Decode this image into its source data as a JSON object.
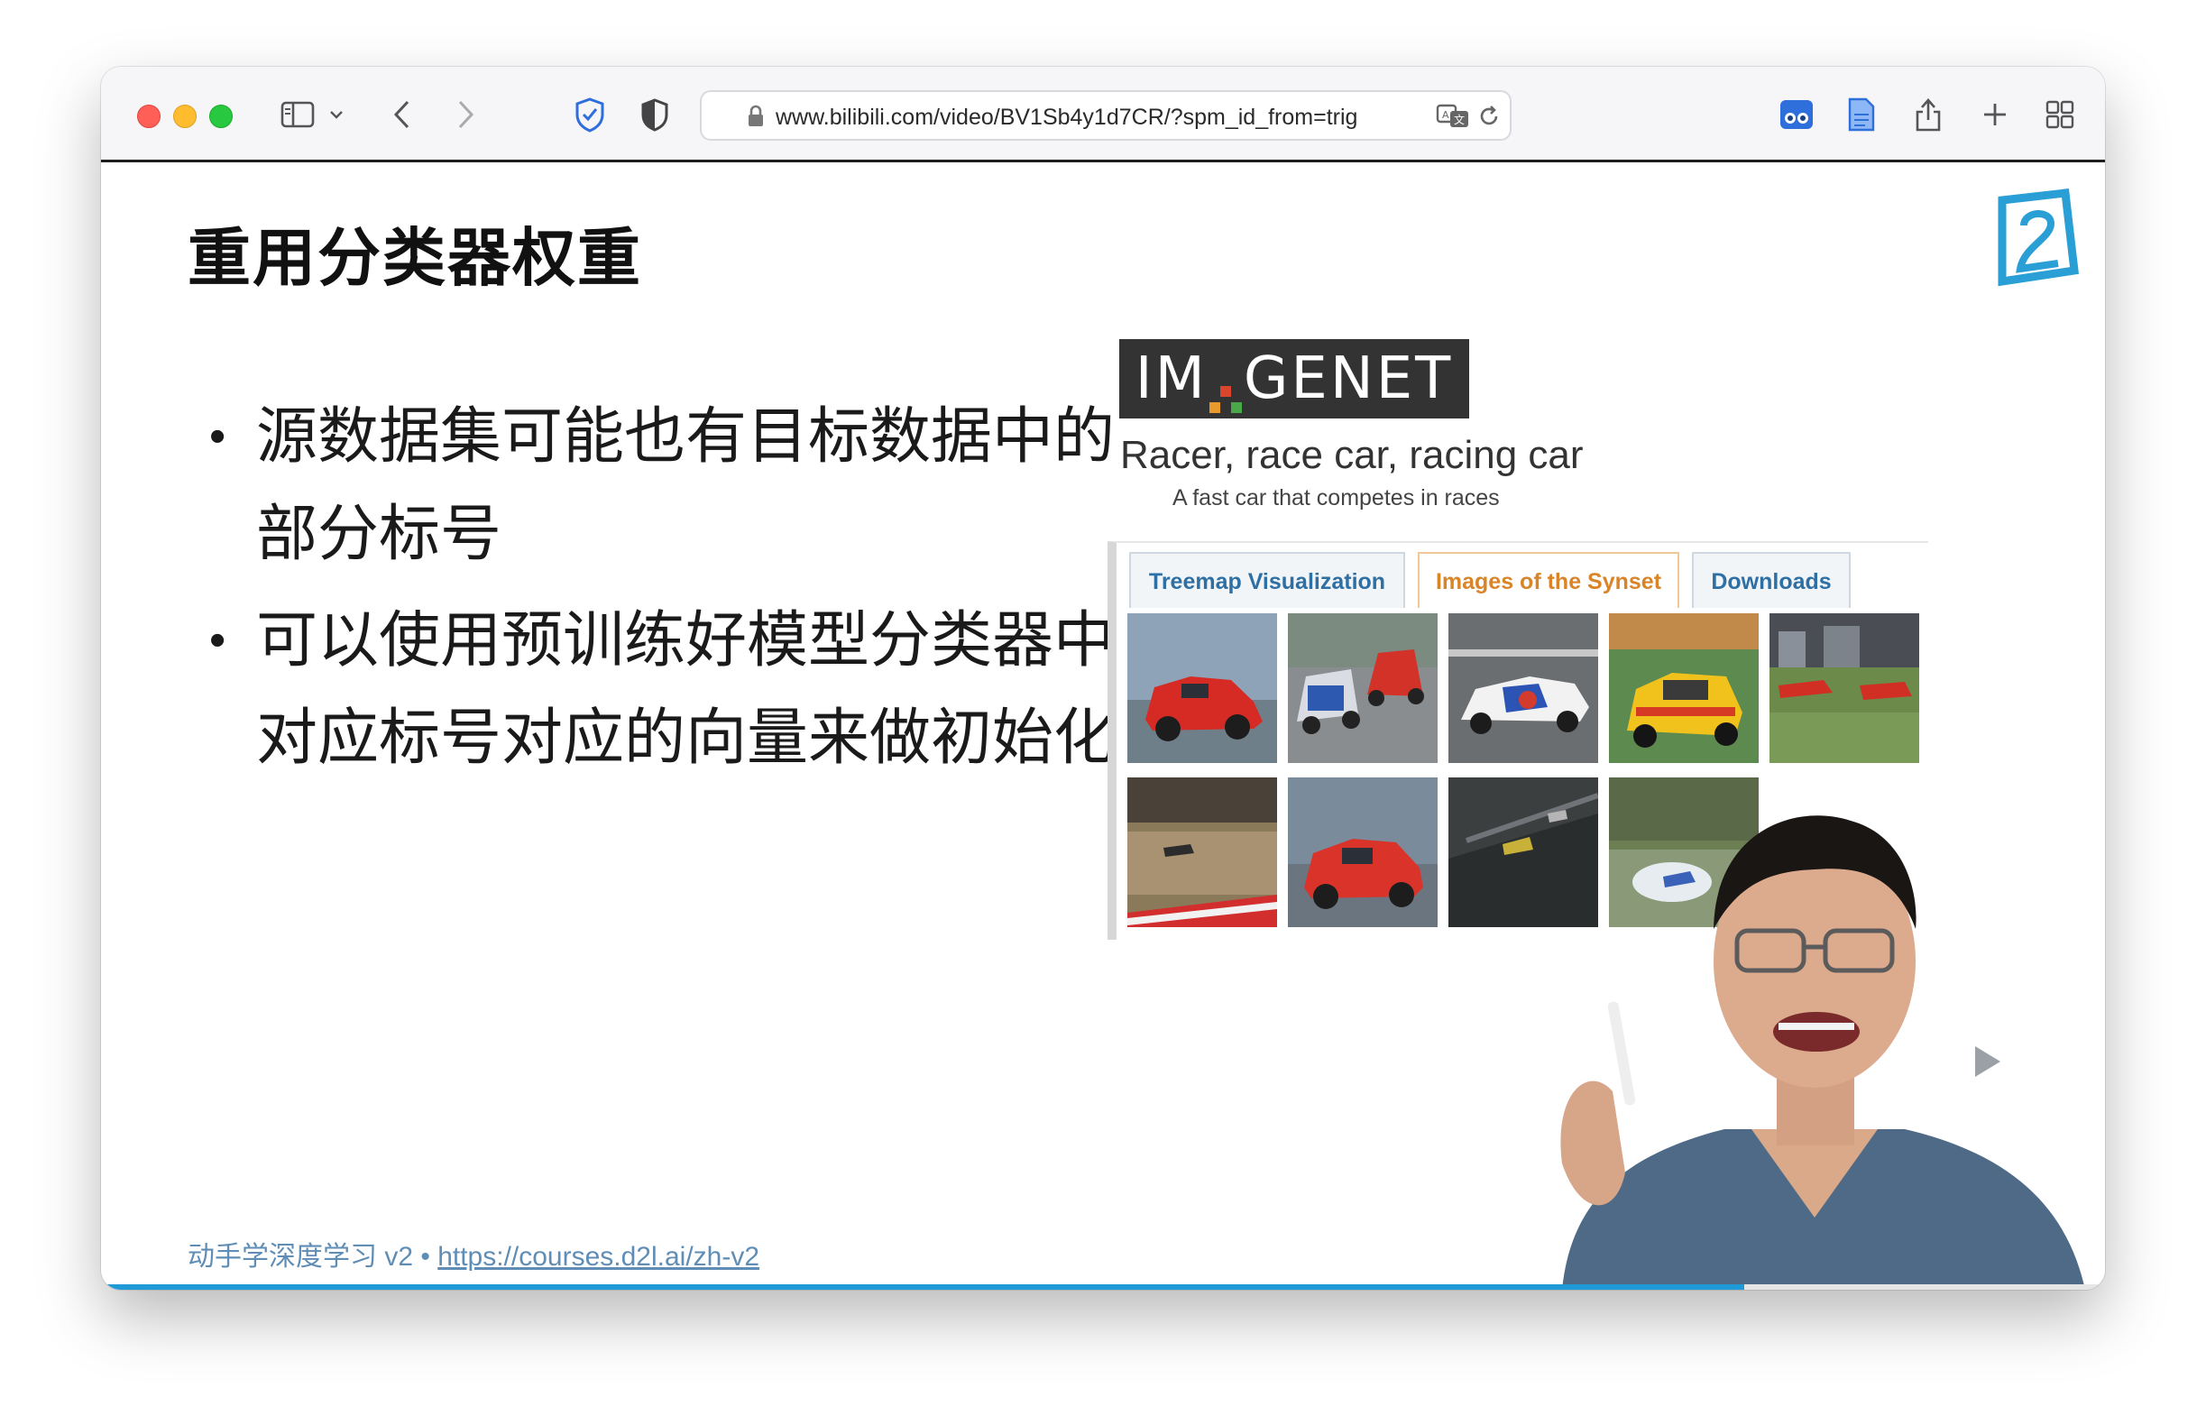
{
  "browser": {
    "url": "www.bilibili.com/video/BV1Sb4y1d7CR/?spm_id_from=trig"
  },
  "slide": {
    "title": "重用分类器权重",
    "bullets": [
      "源数据集可能也有目标数据中的部分标号",
      "可以使用预训练好模型分类器中对应标号对应的向量来做初始化"
    ],
    "imagenet": {
      "logo_left": "IM",
      "logo_right": "GENET",
      "synset_title": "Racer, race car, racing car",
      "synset_subtitle": "A fast car that competes in races",
      "tabs": [
        "Treemap Visualization",
        "Images of the Synset",
        "Downloads"
      ],
      "active_tab": "Images of the Synset"
    },
    "footer": {
      "text": "动手学深度学习 v2 • ",
      "link": "https://courses.d2l.ai/zh-v2"
    }
  },
  "video": {
    "progress_fraction": 0.82
  },
  "colors": {
    "accent_blue": "#1f9ad6",
    "tab_blue": "#2e6fa4",
    "tab_orange": "#d98428",
    "footer_blue": "#5f8db5"
  },
  "icons": [
    "sidebar-icon",
    "chevron-down-icon",
    "back-icon",
    "forward-icon",
    "shield-check-icon",
    "privacy-shield-icon",
    "lock-icon",
    "translate-icon",
    "reload-icon",
    "extension-icon",
    "reader-icon",
    "share-icon",
    "new-tab-icon",
    "tab-overview-icon",
    "bilibili-watermark-icon",
    "play-icon"
  ]
}
